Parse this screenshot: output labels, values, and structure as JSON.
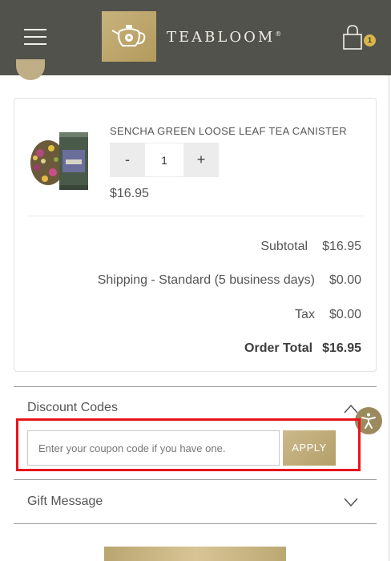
{
  "header": {
    "brand": "TEABLOOM",
    "trademark": "®",
    "cart_count": "1",
    "icons": {
      "menu": "hamburger-menu-icon",
      "logo": "teapot-logo-icon",
      "cart": "shopping-bag-icon"
    }
  },
  "order": {
    "product": {
      "name": "SENCHA GREEN LOOSE LEAF TEA CANISTER",
      "quantity": "1",
      "decrement_label": "-",
      "increment_label": "+",
      "price": "$16.95"
    },
    "summary": {
      "subtotal_label": "Subtotal",
      "subtotal_value": "$16.95",
      "shipping_label": "Shipping - Standard (5 business days)",
      "shipping_value": "$0.00",
      "tax_label": "Tax",
      "tax_value": "$0.00",
      "total_label": "Order Total",
      "total_value": "$16.95"
    }
  },
  "discount": {
    "title": "Discount Codes",
    "placeholder": "Enter your coupon code if you have one.",
    "apply_label": "APPLY",
    "expanded": true
  },
  "gift": {
    "title": "Gift Message",
    "expanded": false
  },
  "colors": {
    "header_bg": "#52524c",
    "gold": "#c8b37e",
    "highlight": "#e8141b"
  }
}
